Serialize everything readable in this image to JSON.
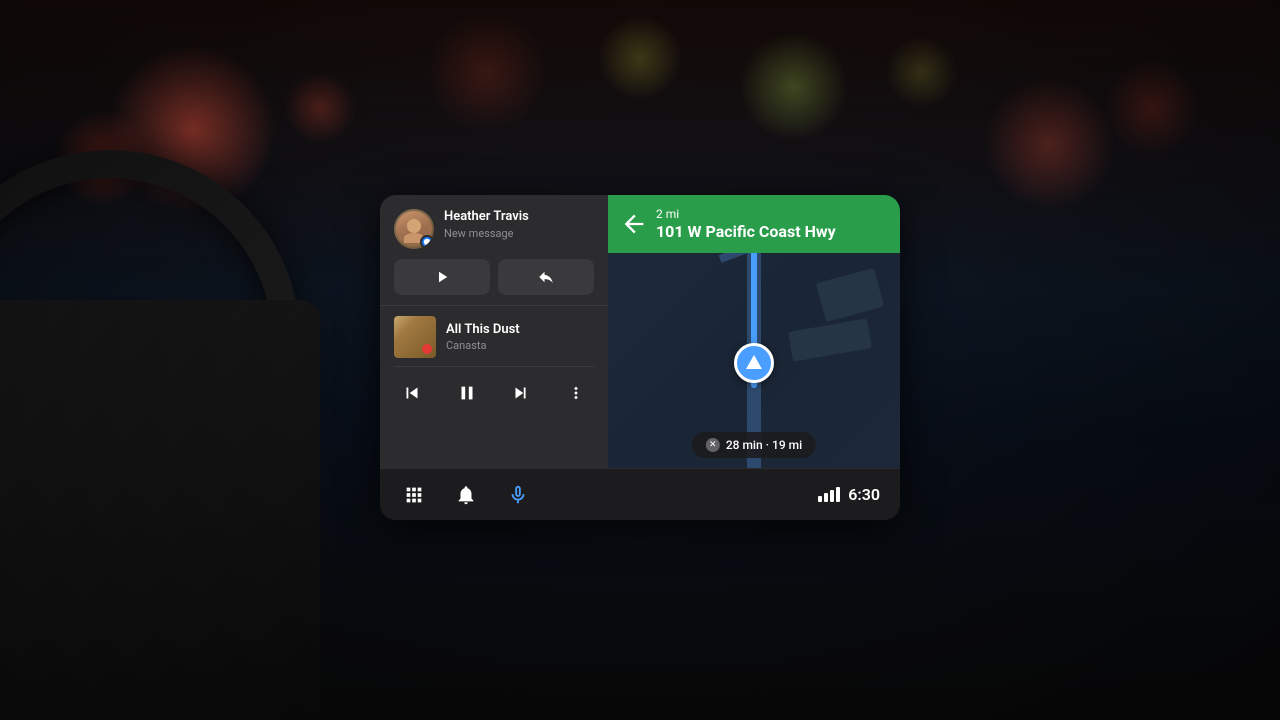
{
  "background": {
    "color": "#1a0a0a"
  },
  "screen": {
    "notification": {
      "contact_name": "Heather Travis",
      "subtitle": "New message",
      "badge_icon": "messenger-icon",
      "actions": [
        {
          "icon": "play-icon",
          "label": "Play"
        },
        {
          "icon": "reply-icon",
          "label": "Reply"
        }
      ]
    },
    "music": {
      "song_title": "All This Dust",
      "artist": "Canasta",
      "controls": [
        {
          "icon": "skip-back-icon",
          "label": "Previous"
        },
        {
          "icon": "pause-icon",
          "label": "Pause"
        },
        {
          "icon": "skip-forward-icon",
          "label": "Next"
        },
        {
          "icon": "more-icon",
          "label": "More"
        }
      ]
    },
    "navigation": {
      "turn_direction": "left",
      "distance": "2 mi",
      "street": "101 W Pacific Coast Hwy",
      "eta_time": "28 min",
      "eta_distance": "19 mi"
    },
    "bottom_bar": {
      "icons": [
        {
          "name": "apps-icon",
          "label": "Apps"
        },
        {
          "name": "notifications-icon",
          "label": "Notifications"
        },
        {
          "name": "microphone-icon",
          "label": "Microphone"
        }
      ],
      "signal_bars": 4,
      "clock": "6:30"
    }
  }
}
